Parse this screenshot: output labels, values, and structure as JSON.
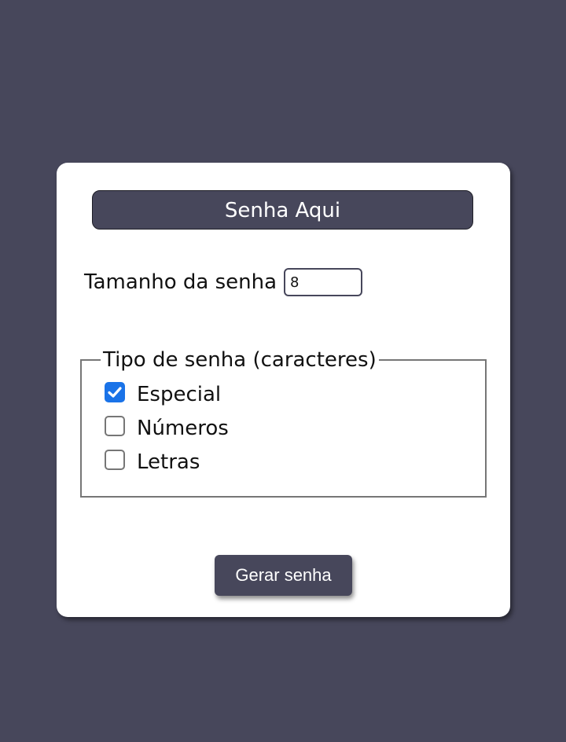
{
  "password_display": {
    "text": "Senha Aqui"
  },
  "length": {
    "label": "Tamanho da senha",
    "value": "8"
  },
  "char_types": {
    "legend": "Tipo de senha (caracteres)",
    "options": [
      {
        "label": "Especial",
        "checked": true
      },
      {
        "label": "Números",
        "checked": false
      },
      {
        "label": "Letras",
        "checked": false
      }
    ]
  },
  "generate_button": {
    "label": "Gerar senha"
  },
  "colors": {
    "background": "#47475b",
    "card": "#ffffff",
    "accent": "#47475b",
    "checkbox_checked": "#1a73e8"
  },
  "icons": {
    "check": "check-icon"
  }
}
